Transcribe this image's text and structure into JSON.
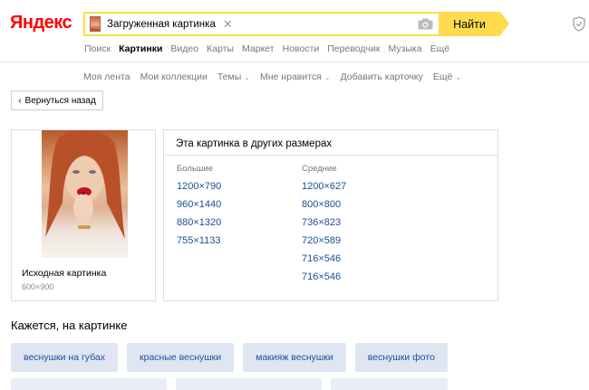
{
  "logo": "Яндекс",
  "search": {
    "query": "Загруженная картинка",
    "clear_icon": "close-icon",
    "camera_icon": "camera-icon",
    "button": "Найти"
  },
  "services": [
    "Поиск",
    "Картинки",
    "Видео",
    "Карты",
    "Маркет",
    "Новости",
    "Переводчик",
    "Музыка",
    "Ещё"
  ],
  "active_service": "Картинки",
  "subnav": [
    {
      "label": "Моя лента",
      "dropdown": false
    },
    {
      "label": "Мои коллекции",
      "dropdown": false
    },
    {
      "label": "Темы",
      "dropdown": true
    },
    {
      "label": "Мне нравится",
      "dropdown": true
    },
    {
      "label": "Добавить карточку",
      "dropdown": false
    },
    {
      "label": "Ещё",
      "dropdown": true
    }
  ],
  "back_button": "Вернуться назад",
  "original": {
    "label": "Исходная картинка",
    "size": "600×900"
  },
  "other_sizes": {
    "title": "Эта картинка в других размерах",
    "large_label": "Большие",
    "large": [
      "1200×790",
      "960×1440",
      "880×1320",
      "755×1133"
    ],
    "medium_label": "Средние",
    "medium": [
      "1200×627",
      "800×800",
      "736×823",
      "720×589",
      "716×546",
      "716×546"
    ]
  },
  "similar": {
    "title": "Кажется, на картинке",
    "tags": [
      "веснушки на губах",
      "красные веснушки",
      "макияж веснушки",
      "веснушки фото"
    ]
  },
  "colors": {
    "accent": "#ffdb4d",
    "link": "#1a4e95",
    "chip_bg": "#dfe6f2",
    "logo_red": "#ff0000"
  }
}
